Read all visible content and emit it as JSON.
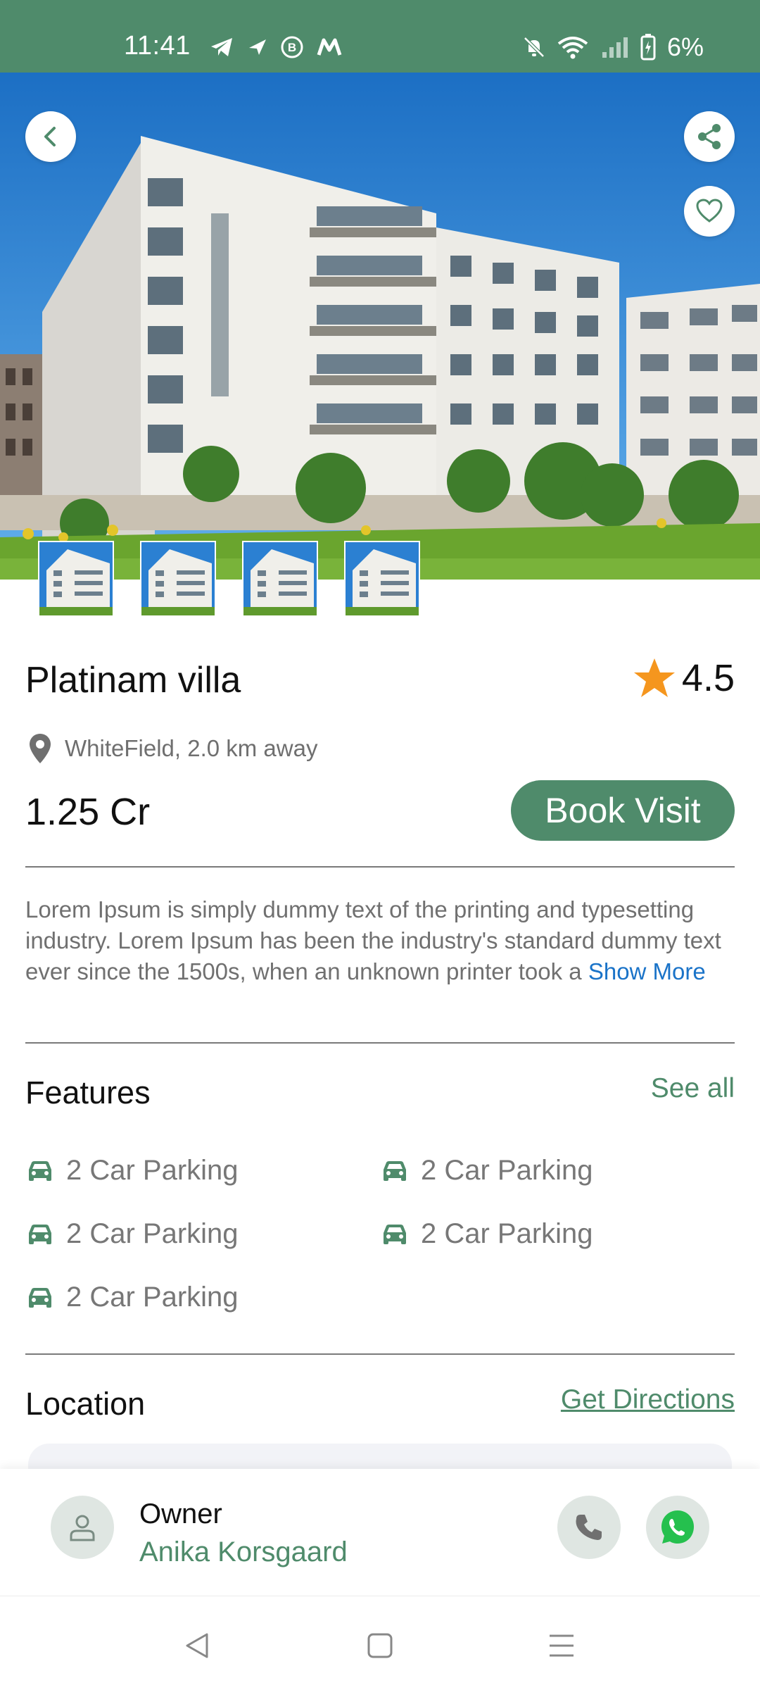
{
  "status_bar": {
    "time": "11:41",
    "battery": "6%",
    "icons_left": [
      "telegram-icon",
      "flight-icon",
      "b-icon",
      "m-icon"
    ],
    "icons_right": [
      "mute-icon",
      "wifi-icon",
      "signal-icon",
      "battery-icon"
    ]
  },
  "hero": {
    "thumbnails_count": 4
  },
  "property": {
    "title": "Platinam villa",
    "rating": "4.5",
    "location": "WhiteField, 2.0 km away",
    "price": "1.25 Cr",
    "book_label": "Book Visit",
    "description": "Lorem Ipsum is simply dummy text of the printing and typesetting industry. Lorem Ipsum has been the industry's standard dummy text ever since the 1500s, when an unknown printer took a ",
    "show_more": "Show More"
  },
  "features": {
    "title": "Features",
    "see_all": "See all",
    "items": [
      "2 Car Parking",
      "2 Car Parking",
      "2 Car Parking",
      "2 Car Parking",
      "2 Car Parking"
    ]
  },
  "location": {
    "title": "Location",
    "directions": "Get Directions"
  },
  "owner": {
    "role": "Owner",
    "name": "Anika Korsgaard"
  },
  "colors": {
    "accent": "#4f8b6b",
    "link": "#1a73c8",
    "star": "#f5961e"
  }
}
